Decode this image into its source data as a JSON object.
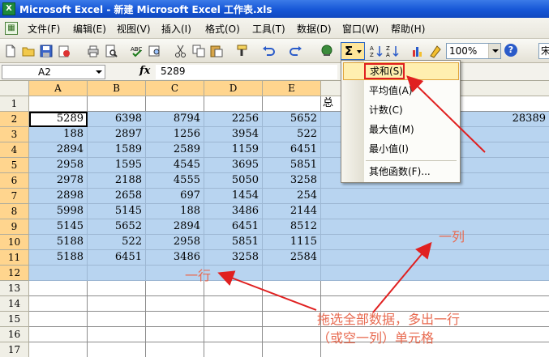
{
  "window": {
    "title": "Microsoft Excel - 新建 Microsoft Excel 工作表.xls",
    "app_icon": "excel-icon"
  },
  "menu": {
    "items": [
      "文件(F)",
      "编辑(E)",
      "视图(V)",
      "插入(I)",
      "格式(O)",
      "工具(T)",
      "数据(D)",
      "窗口(W)",
      "帮助(H)"
    ]
  },
  "toolbar": {
    "sigma_label": "Σ",
    "zoom_value": "100%",
    "help_label": "?",
    "font_partial": "宋"
  },
  "formula_bar": {
    "name_box": "A2",
    "fx_label": "fx",
    "value": "5289"
  },
  "sheet": {
    "columns": [
      "A",
      "B",
      "C",
      "D",
      "E"
    ],
    "row_numbers": [
      "1",
      "2",
      "3",
      "4",
      "5",
      "6",
      "7",
      "8",
      "9",
      "10",
      "11",
      "12",
      "13",
      "14",
      "15",
      "16",
      "17"
    ],
    "row1_text": "总",
    "g2_value": "28389",
    "rows": [
      [
        "5289",
        "6398",
        "8794",
        "2256",
        "5652"
      ],
      [
        "188",
        "2897",
        "1256",
        "3954",
        "522"
      ],
      [
        "2894",
        "1589",
        "2589",
        "1159",
        "6451"
      ],
      [
        "2958",
        "1595",
        "4545",
        "3695",
        "5851"
      ],
      [
        "2978",
        "2188",
        "4555",
        "5050",
        "3258"
      ],
      [
        "2898",
        "2658",
        "697",
        "1454",
        "254"
      ],
      [
        "5998",
        "5145",
        "188",
        "3486",
        "2144"
      ],
      [
        "5145",
        "5652",
        "2894",
        "6451",
        "8512"
      ],
      [
        "5188",
        "522",
        "2958",
        "5851",
        "1115"
      ],
      [
        "5188",
        "6451",
        "3486",
        "3258",
        "2584"
      ]
    ]
  },
  "autosum_menu": {
    "items": [
      "求和(S)",
      "平均值(A)",
      "计数(C)",
      "最大值(M)",
      "最小值(I)",
      "其他函数(F)..."
    ],
    "highlighted_index": 0
  },
  "annotations": {
    "one_column": "一列",
    "one_row": "一行",
    "instruction_line1": "拖选全部数据，多出一行",
    "instruction_line2": "（或空一列）单元格",
    "color": "#e86a50"
  },
  "colors": {
    "selection": "#b8d4f0",
    "highlight_header": "#ffd58e",
    "title_bar": "#1656d6",
    "red_box": "#e02020"
  }
}
